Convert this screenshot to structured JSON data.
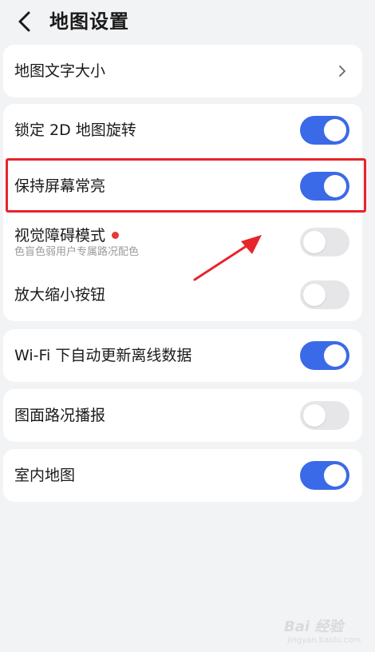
{
  "header": {
    "title": "地图设置"
  },
  "sections": [
    {
      "rows": [
        {
          "id": "map-text-size",
          "title": "地图文字大小",
          "control": "chevron"
        }
      ]
    },
    {
      "rows": [
        {
          "id": "lock-2d-rotation",
          "title": "锁定 2D 地图旋转",
          "control": "toggle",
          "on": true
        },
        {
          "id": "keep-screen-on",
          "title": "保持屏幕常亮",
          "control": "toggle",
          "on": true,
          "highlighted": true
        },
        {
          "id": "visual-impairment-mode",
          "title": "视觉障碍模式",
          "subtitle": "色盲色弱用户专属路况配色",
          "control": "toggle",
          "on": false,
          "badge": "red-dot"
        },
        {
          "id": "zoom-buttons",
          "title": "放大缩小按钮",
          "control": "toggle",
          "on": false
        }
      ]
    },
    {
      "rows": [
        {
          "id": "wifi-auto-update",
          "title": "Wi-Fi 下自动更新离线数据",
          "control": "toggle",
          "on": true
        }
      ]
    },
    {
      "rows": [
        {
          "id": "traffic-broadcast",
          "title": "图面路况播报",
          "control": "toggle",
          "on": false
        }
      ]
    },
    {
      "rows": [
        {
          "id": "indoor-map",
          "title": "室内地图",
          "control": "toggle",
          "on": true
        }
      ]
    }
  ],
  "colors": {
    "toggle_on": "#3a6ae8",
    "toggle_off": "#e6e6e8",
    "highlight": "#e8232b",
    "background": "#f2f3f5"
  },
  "watermark": {
    "text": "Bai 经验",
    "url": "jingyan.baidu.com"
  }
}
